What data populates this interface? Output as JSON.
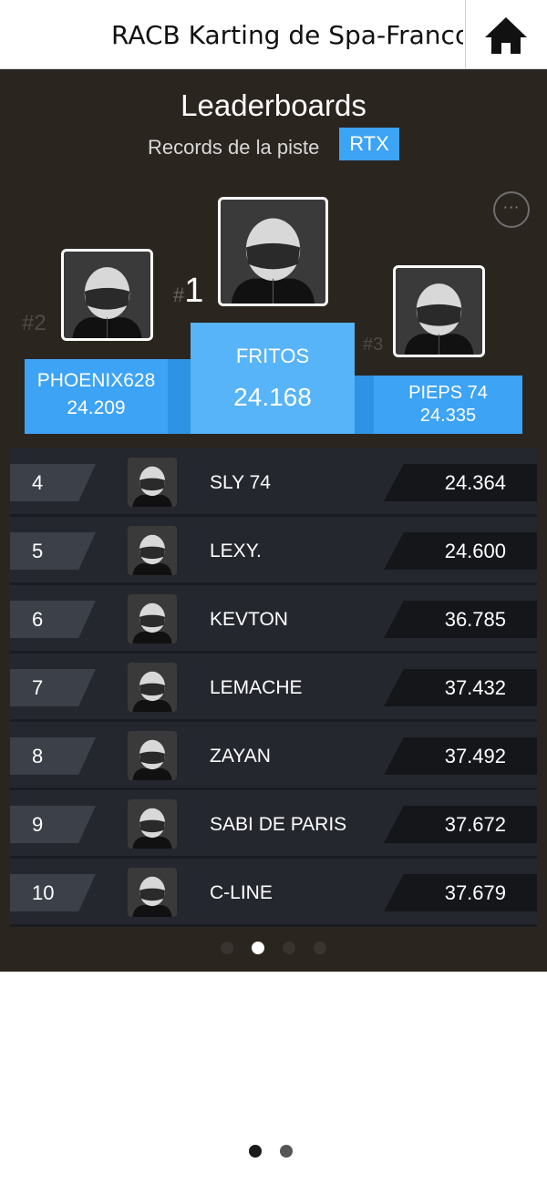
{
  "header": {
    "title": "RACB Karting de Spa-Francor...",
    "home_icon": "home-icon"
  },
  "leaderboard": {
    "title": "Leaderboards",
    "subtitle": "Records de la piste",
    "category": "RTX",
    "more_icon": "more-icon",
    "more_glyph": "···",
    "podium": {
      "first": {
        "rank_hash": "#",
        "rank_num": "1",
        "name": "FRITOS",
        "time": "24.168"
      },
      "second": {
        "rank_label": "#2",
        "name": "PHOENIX628",
        "time": "24.209"
      },
      "third": {
        "rank_label": "#3",
        "name": "PIEPS 74",
        "time": "24.335"
      }
    },
    "rows": [
      {
        "rank": "4",
        "name": "SLY 74",
        "time": "24.364"
      },
      {
        "rank": "5",
        "name": "LEXY.",
        "time": "24.600"
      },
      {
        "rank": "6",
        "name": "KEVTON",
        "time": "36.785"
      },
      {
        "rank": "7",
        "name": "LEMACHE",
        "time": "37.432"
      },
      {
        "rank": "8",
        "name": "ZAYAN",
        "time": "37.492"
      },
      {
        "rank": "9",
        "name": "SABI DE PARIS",
        "time": "37.672"
      },
      {
        "rank": "10",
        "name": "C-LINE",
        "time": "37.679"
      }
    ],
    "pagination": {
      "count": 4,
      "active": 1
    }
  },
  "bottom_pagination": {
    "count": 2,
    "active": 0
  },
  "colors": {
    "accent": "#3da3f5",
    "panel_bg": "#2b2520",
    "row_bg": "#24272e"
  }
}
